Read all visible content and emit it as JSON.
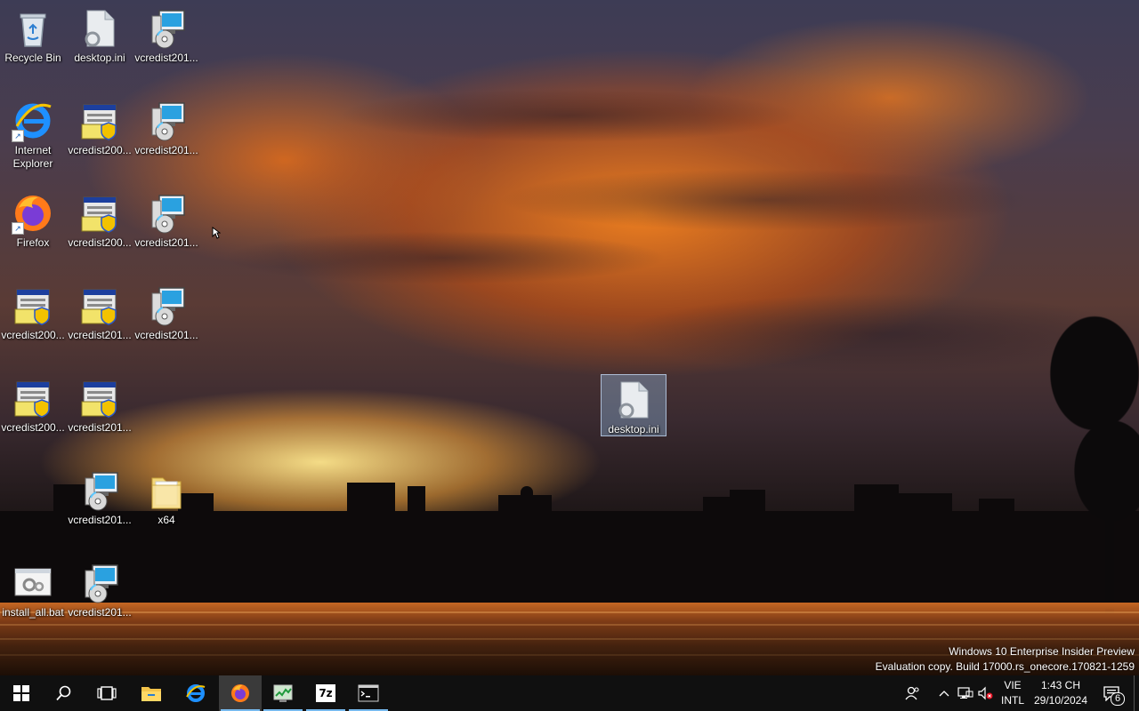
{
  "desktop": {
    "icons": [
      {
        "label": "Recycle Bin",
        "icon": "recycle-bin-icon"
      },
      {
        "label": "desktop.ini",
        "icon": "config-file-icon"
      },
      {
        "label": "vcredist201...",
        "icon": "installer-cd-icon"
      },
      {
        "label": "Internet\nExplorer",
        "icon": "internet-explorer-icon"
      },
      {
        "label": "vcredist200...",
        "icon": "installer-shield-icon"
      },
      {
        "label": "vcredist201...",
        "icon": "installer-cd-icon"
      },
      {
        "label": "Firefox",
        "icon": "firefox-icon"
      },
      {
        "label": "vcredist200...",
        "icon": "installer-shield-icon"
      },
      {
        "label": "vcredist201...",
        "icon": "installer-cd-icon"
      },
      {
        "label": "vcredist200...",
        "icon": "installer-shield-icon"
      },
      {
        "label": "vcredist201...",
        "icon": "installer-shield-icon"
      },
      {
        "label": "vcredist201...",
        "icon": "installer-cd-icon"
      },
      {
        "label": "vcredist200...",
        "icon": "installer-shield-icon"
      },
      {
        "label": "vcredist201...",
        "icon": "installer-shield-icon"
      },
      {
        "label": "vcredist201...",
        "icon": "installer-cd-icon"
      },
      {
        "label": "x64",
        "icon": "folder-icon"
      },
      {
        "label": "install_all.bat",
        "icon": "batch-file-icon"
      },
      {
        "label": "vcredist201...",
        "icon": "installer-cd-icon"
      },
      {
        "label": "desktop.ini",
        "icon": "config-file-icon"
      }
    ]
  },
  "watermark": {
    "line1": "Windows 10 Enterprise Insider Preview",
    "line2": "Evaluation copy. Build 17000.rs_onecore.170821-1259"
  },
  "taskbar": {
    "start": "start-icon",
    "search": "search-icon",
    "taskview": "task-view-icon",
    "apps": [
      {
        "name": "File Explorer",
        "icon": "file-explorer-icon"
      },
      {
        "name": "Internet Explorer",
        "icon": "internet-explorer-icon"
      },
      {
        "name": "Firefox",
        "icon": "firefox-icon"
      },
      {
        "name": "Task Manager",
        "icon": "task-manager-icon"
      },
      {
        "name": "7-Zip",
        "icon": "7zip-icon"
      },
      {
        "name": "Command Prompt",
        "icon": "command-prompt-icon"
      }
    ],
    "app_7zip_text": "7z",
    "language": {
      "line1": "VIE",
      "line2": "INTL"
    },
    "clock": {
      "time": "1:43 CH",
      "date": "29/10/2024"
    },
    "notifications_count": "6"
  },
  "colors": {
    "taskbar": "#101010",
    "accent": "#76b9ed",
    "selection": "#99c7f0"
  }
}
